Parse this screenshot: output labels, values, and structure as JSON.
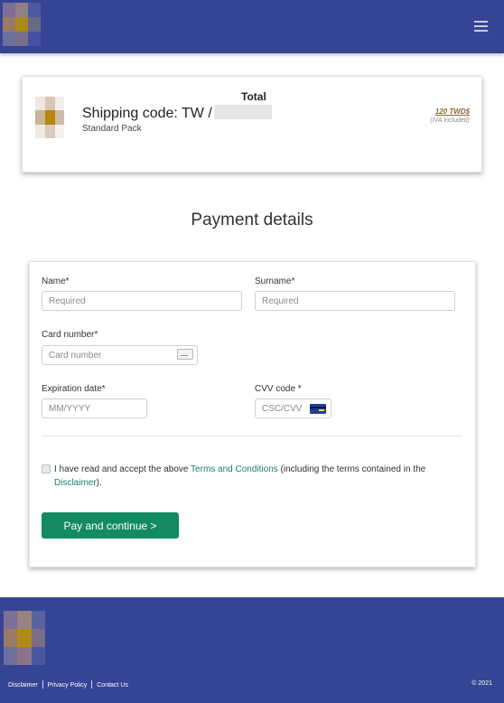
{
  "header": {
    "logo_icon": "brand-logo-icon",
    "menu_icon": "hamburger-menu-icon",
    "bg_color": "#364494"
  },
  "order": {
    "total_label": "Total",
    "shipping_code": "Shipping code: TW /",
    "pack": "Standard Pack",
    "price": "120 TWD$",
    "tax_note": "(IVA Included)"
  },
  "payment": {
    "title": "Payment details",
    "name_label": "Name*",
    "name_placeholder": "Required",
    "surname_label": "Surname*",
    "surname_placeholder": "Required",
    "card_label": "Card number*",
    "card_placeholder": "Card number",
    "expiry_label": "Expiration date*",
    "expiry_placeholder": "MM/YYYY",
    "cvv_label": "CVV code *",
    "cvv_placeholder": "CSC/CVV",
    "terms_prefix": "I have read and accept the above ",
    "terms_link": "Terms and Conditions",
    "terms_middle": " (including the terms contained in the ",
    "disclaimer_link": "Disclaimer",
    "terms_suffix": ").",
    "pay_button": "Pay and continue >",
    "button_color": "#138a64"
  },
  "footer": {
    "links": [
      "Disclaimer",
      "Privacy Policy",
      "Contact Us"
    ],
    "copyright": "© 2021"
  }
}
